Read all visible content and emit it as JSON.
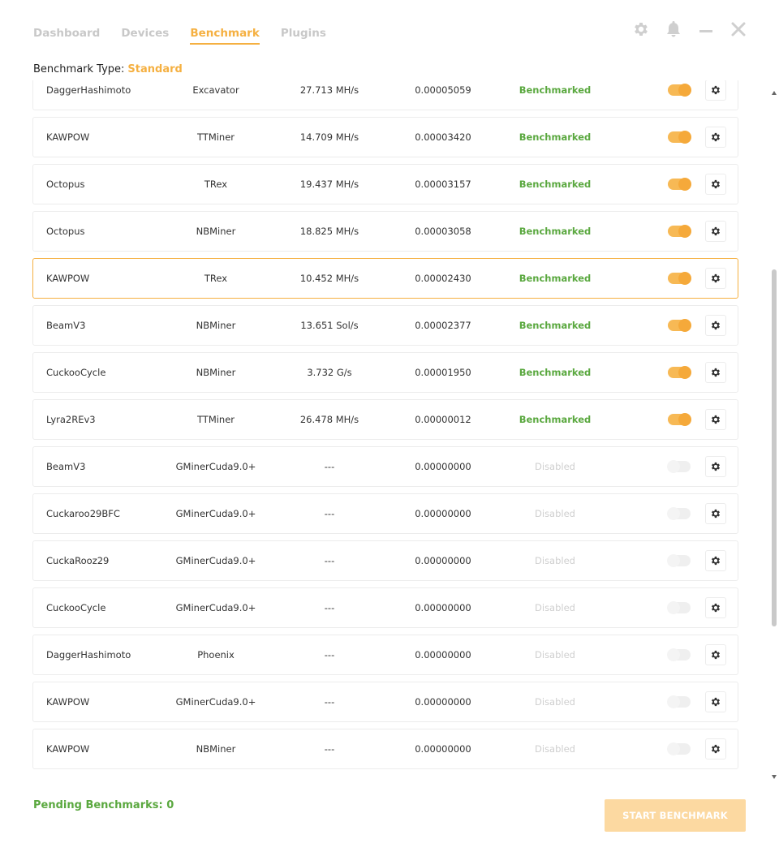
{
  "tabs": [
    {
      "label": "Dashboard",
      "active": false
    },
    {
      "label": "Devices",
      "active": false
    },
    {
      "label": "Benchmark",
      "active": true
    },
    {
      "label": "Plugins",
      "active": false
    }
  ],
  "window_controls": [
    "settings-icon",
    "bell-icon",
    "minimize-icon",
    "close-icon"
  ],
  "benchmark_type": {
    "label": "Benchmark Type:",
    "value": "Standard"
  },
  "rows": [
    {
      "algorithm": "DaggerHashimoto",
      "miner": "Excavator",
      "speed": "27.713 MH/s",
      "profit": "0.00005059",
      "status": "Benchmarked",
      "enabled": true,
      "selected": false
    },
    {
      "algorithm": "KAWPOW",
      "miner": "TTMiner",
      "speed": "14.709 MH/s",
      "profit": "0.00003420",
      "status": "Benchmarked",
      "enabled": true,
      "selected": false
    },
    {
      "algorithm": "Octopus",
      "miner": "TRex",
      "speed": "19.437 MH/s",
      "profit": "0.00003157",
      "status": "Benchmarked",
      "enabled": true,
      "selected": false
    },
    {
      "algorithm": "Octopus",
      "miner": "NBMiner",
      "speed": "18.825 MH/s",
      "profit": "0.00003058",
      "status": "Benchmarked",
      "enabled": true,
      "selected": false
    },
    {
      "algorithm": "KAWPOW",
      "miner": "TRex",
      "speed": "10.452 MH/s",
      "profit": "0.00002430",
      "status": "Benchmarked",
      "enabled": true,
      "selected": true
    },
    {
      "algorithm": "BeamV3",
      "miner": "NBMiner",
      "speed": "13.651 Sol/s",
      "profit": "0.00002377",
      "status": "Benchmarked",
      "enabled": true,
      "selected": false
    },
    {
      "algorithm": "CuckooCycle",
      "miner": "NBMiner",
      "speed": "3.732 G/s",
      "profit": "0.00001950",
      "status": "Benchmarked",
      "enabled": true,
      "selected": false
    },
    {
      "algorithm": "Lyra2REv3",
      "miner": "TTMiner",
      "speed": "26.478 MH/s",
      "profit": "0.00000012",
      "status": "Benchmarked",
      "enabled": true,
      "selected": false
    },
    {
      "algorithm": "BeamV3",
      "miner": "GMinerCuda9.0+",
      "speed": "---",
      "profit": "0.00000000",
      "status": "Disabled",
      "enabled": false,
      "selected": false
    },
    {
      "algorithm": "Cuckaroo29BFC",
      "miner": "GMinerCuda9.0+",
      "speed": "---",
      "profit": "0.00000000",
      "status": "Disabled",
      "enabled": false,
      "selected": false
    },
    {
      "algorithm": "CuckaRooz29",
      "miner": "GMinerCuda9.0+",
      "speed": "---",
      "profit": "0.00000000",
      "status": "Disabled",
      "enabled": false,
      "selected": false
    },
    {
      "algorithm": "CuckooCycle",
      "miner": "GMinerCuda9.0+",
      "speed": "---",
      "profit": "0.00000000",
      "status": "Disabled",
      "enabled": false,
      "selected": false
    },
    {
      "algorithm": "DaggerHashimoto",
      "miner": "Phoenix",
      "speed": "---",
      "profit": "0.00000000",
      "status": "Disabled",
      "enabled": false,
      "selected": false
    },
    {
      "algorithm": "KAWPOW",
      "miner": "GMinerCuda9.0+",
      "speed": "---",
      "profit": "0.00000000",
      "status": "Disabled",
      "enabled": false,
      "selected": false
    },
    {
      "algorithm": "KAWPOW",
      "miner": "NBMiner",
      "speed": "---",
      "profit": "0.00000000",
      "status": "Disabled",
      "enabled": false,
      "selected": false
    }
  ],
  "footer": {
    "pending_label": "Pending Benchmarks: 0",
    "start_button": "START BENCHMARK"
  },
  "colors": {
    "accent": "#f5b041",
    "success": "#5aa83f",
    "disabled_text": "#cfcfcf",
    "button_disabled_bg": "#fcd9a1"
  }
}
